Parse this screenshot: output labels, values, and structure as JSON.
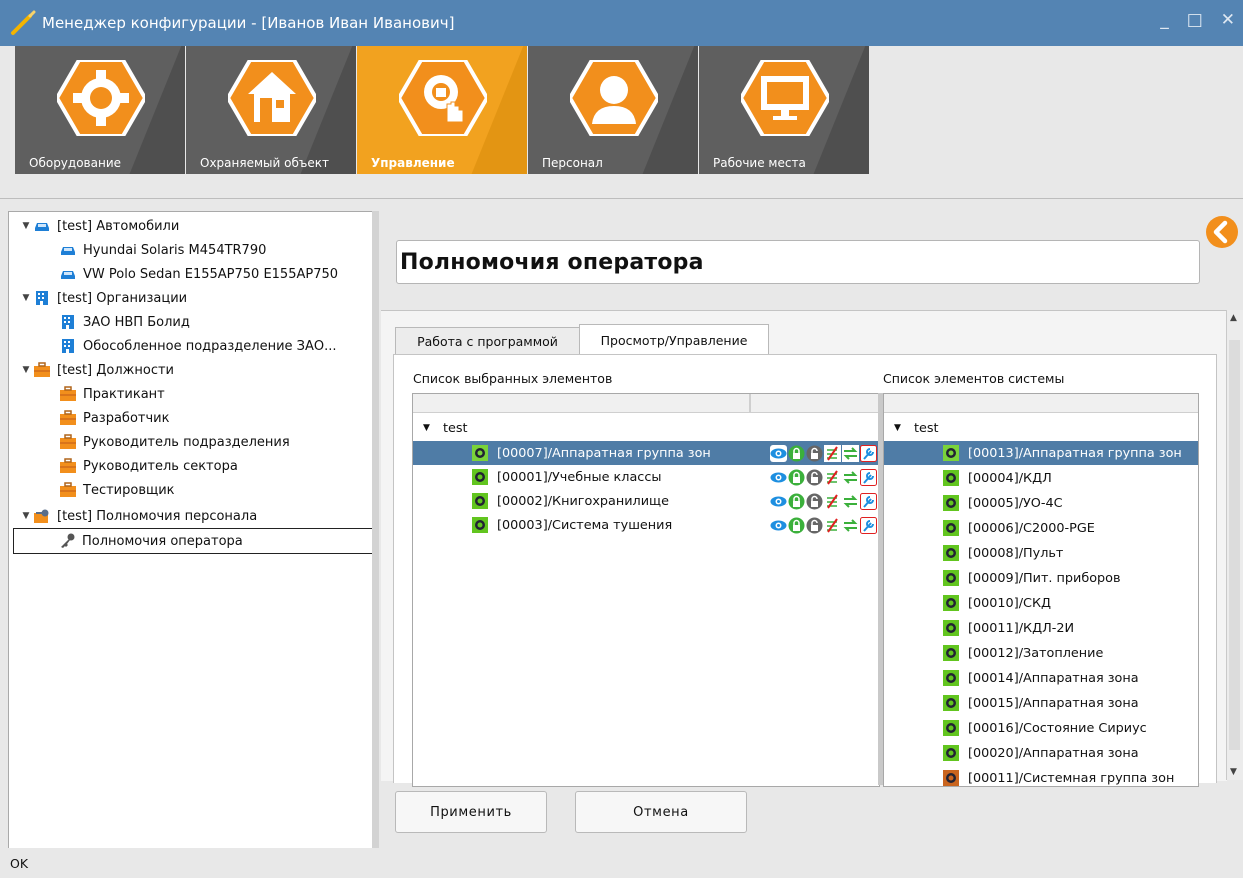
{
  "window": {
    "title": "Менеджер конфигурации - [Иванов Иван Иванович]",
    "controls": [
      "_",
      "□",
      "✕"
    ]
  },
  "toolbar": {
    "tiles": [
      {
        "label": "Оборудование",
        "icon": "gear-icon",
        "active": false
      },
      {
        "label": "Охраняемый объект",
        "icon": "house-icon",
        "active": false
      },
      {
        "label": "Управление",
        "icon": "lock-gear-hand-icon",
        "active": true
      },
      {
        "label": "Персонал",
        "icon": "person-icon",
        "active": false
      },
      {
        "label": "Рабочие места",
        "icon": "monitor-icon",
        "active": false
      }
    ]
  },
  "sidebar": {
    "items": [
      {
        "label": "[test] Автомобили",
        "icon": "car-icon",
        "level": 0,
        "expanded": true
      },
      {
        "label": "Hyundai Solaris M454TR790",
        "icon": "car-icon",
        "level": 1
      },
      {
        "label": "VW Polo Sedan E155AP750 E155AP750",
        "icon": "car-icon",
        "level": 1
      },
      {
        "label": "[test] Организации",
        "icon": "building-icon",
        "level": 0,
        "expanded": true
      },
      {
        "label": "ЗАО НВП Болид",
        "icon": "building-icon",
        "level": 1
      },
      {
        "label": "Обособленное подразделение ЗАО...",
        "icon": "building-icon",
        "level": 1
      },
      {
        "label": "[test] Должности",
        "icon": "briefcase-icon",
        "level": 0,
        "expanded": true
      },
      {
        "label": "Практикант",
        "icon": "briefcase-icon",
        "level": 1
      },
      {
        "label": "Разработчик",
        "icon": "briefcase-icon",
        "level": 1
      },
      {
        "label": "Руководитель подразделения",
        "icon": "briefcase-icon",
        "level": 1
      },
      {
        "label": "Руководитель сектора",
        "icon": "briefcase-icon",
        "level": 1
      },
      {
        "label": "Тестировщик",
        "icon": "briefcase-icon",
        "level": 1
      },
      {
        "label": "[test] Полномочия персонала",
        "icon": "key-folder-icon",
        "level": 0,
        "expanded": true
      },
      {
        "label": "Полномочия оператора",
        "icon": "key-icon",
        "level": 1,
        "selected": true
      }
    ]
  },
  "main": {
    "header": "Полномочия оператора",
    "tabs": [
      {
        "label": "Работа с программой",
        "active": false
      },
      {
        "label": "Просмотр/Управление",
        "active": true
      }
    ],
    "selected_list": {
      "label": "Список выбранных элементов",
      "root": "test",
      "rows": [
        {
          "text": "[00007]/Аппаратная группа зон",
          "selected": true
        },
        {
          "text": "[00001]/Учебные классы",
          "selected": false
        },
        {
          "text": "[00002]/Книгохранилище",
          "selected": false
        },
        {
          "text": "[00003]/Система тушения",
          "selected": false
        }
      ],
      "permission_icons": [
        "eye-icon",
        "lock-closed-icon",
        "lock-open-icon",
        "disarm-icon",
        "transfer-icon",
        "wrench-icon"
      ]
    },
    "system_list": {
      "label": "Список элементов системы",
      "root": "test",
      "rows": [
        {
          "text": "[00013]/Аппаратная группа зон",
          "selected": true
        },
        {
          "text": "[00004]/КДЛ"
        },
        {
          "text": "[00005]/УО-4С"
        },
        {
          "text": "[00006]/С2000-PGE"
        },
        {
          "text": "[00008]/Пульт"
        },
        {
          "text": "[00009]/Пит. приборов"
        },
        {
          "text": "[00010]/СКД"
        },
        {
          "text": "[00011]/КДЛ-2И"
        },
        {
          "text": "[00012]/Затопление"
        },
        {
          "text": "[00014]/Аппаратная зона"
        },
        {
          "text": "[00015]/Аппаратная зона"
        },
        {
          "text": "[00016]/Состояние Сириус"
        },
        {
          "text": "[00020]/Аппаратная зона"
        },
        {
          "text": "[00011]/Системная группа зон"
        }
      ]
    },
    "buttons": {
      "apply": "Применить",
      "cancel": "Отмена"
    }
  },
  "status": {
    "text": "OK"
  },
  "colors": {
    "titlebar": "#5484b3",
    "tile": "#5f5f5f",
    "tile_active": "#f2a21f",
    "hex_orange": "#f28f1c",
    "selection": "#4f7ca6"
  }
}
